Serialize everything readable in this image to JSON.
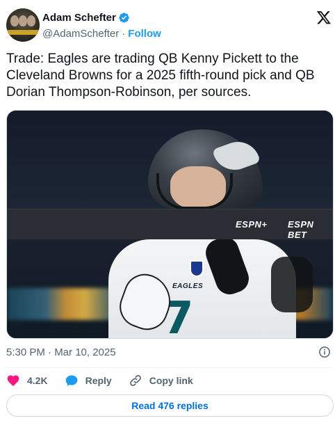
{
  "author": {
    "name": "Adam Schefter",
    "handle": "@AdamSchefter",
    "separator": "·",
    "follow_label": "Follow",
    "verified_icon": "verified-badge-icon",
    "verified_color": "#1d9bf0"
  },
  "platform_logo": "x-logo-icon",
  "tweet": {
    "text": "Trade: Eagles are trading QB Kenny Pickett to the Cleveland Browns for a 2025 fifth-round pick and QB Dorian Thompson-Robinson, per sources."
  },
  "media": {
    "ribbon_logos": [
      "ESPN+",
      "ESPN BET"
    ],
    "jersey_text": "EAGLES",
    "jersey_number": "7"
  },
  "meta": {
    "timestamp": "5:30 PM · Mar 10, 2025",
    "info_icon": "info-icon"
  },
  "actions": {
    "like_count": "4.2K",
    "reply_label": "Reply",
    "copy_link_label": "Copy link",
    "like_color": "#f91880",
    "reply_color": "#1d9bf0"
  },
  "read_replies_label": "Read 476 replies"
}
